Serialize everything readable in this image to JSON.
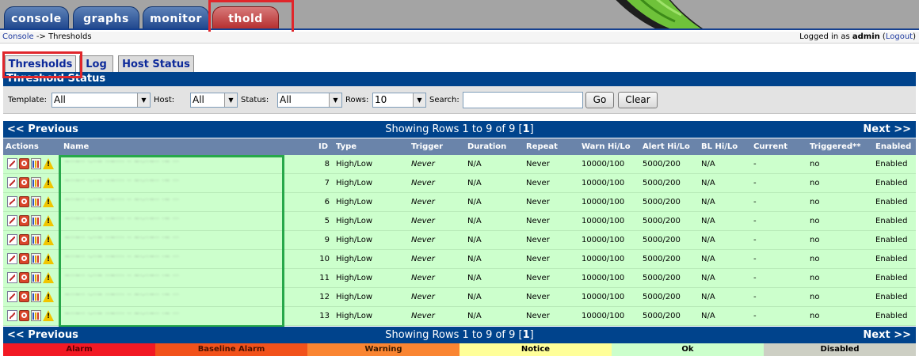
{
  "main_tabs": [
    {
      "label": "console"
    },
    {
      "label": "graphs"
    },
    {
      "label": "monitor"
    },
    {
      "label": "thold"
    }
  ],
  "breadcrumb": {
    "link": "Console",
    "separator": " -> ",
    "current": "Thresholds"
  },
  "login": {
    "prefix": "Logged in as ",
    "user": "admin",
    "open": " (",
    "logout": "Logout",
    "close": ")"
  },
  "sub_tabs": [
    {
      "label": "Thresholds"
    },
    {
      "label": "Log"
    },
    {
      "label": "Host Status"
    }
  ],
  "status_header": "Threshold Status",
  "filters": {
    "template_label": "Template:",
    "template_value": "All",
    "host_label": "Host:",
    "host_value": "All",
    "status_label": "Status:",
    "status_value": "All",
    "rows_label": "Rows:",
    "rows_value": "10",
    "search_label": "Search:",
    "search_value": "",
    "go_label": "Go",
    "clear_label": "Clear"
  },
  "nav": {
    "previous": "<< Previous",
    "showing": "Showing Rows 1 to 9 of 9 [",
    "page": "1",
    "showing_end": "]",
    "next": "Next >>"
  },
  "columns": [
    "Actions",
    "Name",
    "ID",
    "Type",
    "Trigger",
    "Duration",
    "Repeat",
    "Warn Hi/Lo",
    "Alert Hi/Lo",
    "BL Hi/Lo",
    "Current",
    "Triggered**",
    "Enabled"
  ],
  "rows": [
    {
      "id": "8",
      "type": "High/Low",
      "trigger": "Never",
      "duration": "N/A",
      "repeat": "Never",
      "warn": "10000/100",
      "alert": "5000/200",
      "bl": "N/A",
      "current": "-",
      "triggered": "no",
      "enabled": "Enabled"
    },
    {
      "id": "7",
      "type": "High/Low",
      "trigger": "Never",
      "duration": "N/A",
      "repeat": "Never",
      "warn": "10000/100",
      "alert": "5000/200",
      "bl": "N/A",
      "current": "-",
      "triggered": "no",
      "enabled": "Enabled"
    },
    {
      "id": "6",
      "type": "High/Low",
      "trigger": "Never",
      "duration": "N/A",
      "repeat": "Never",
      "warn": "10000/100",
      "alert": "5000/200",
      "bl": "N/A",
      "current": "-",
      "triggered": "no",
      "enabled": "Enabled"
    },
    {
      "id": "5",
      "type": "High/Low",
      "trigger": "Never",
      "duration": "N/A",
      "repeat": "Never",
      "warn": "10000/100",
      "alert": "5000/200",
      "bl": "N/A",
      "current": "-",
      "triggered": "no",
      "enabled": "Enabled"
    },
    {
      "id": "9",
      "type": "High/Low",
      "trigger": "Never",
      "duration": "N/A",
      "repeat": "Never",
      "warn": "10000/100",
      "alert": "5000/200",
      "bl": "N/A",
      "current": "-",
      "triggered": "no",
      "enabled": "Enabled"
    },
    {
      "id": "10",
      "type": "High/Low",
      "trigger": "Never",
      "duration": "N/A",
      "repeat": "Never",
      "warn": "10000/100",
      "alert": "5000/200",
      "bl": "N/A",
      "current": "-",
      "triggered": "no",
      "enabled": "Enabled"
    },
    {
      "id": "11",
      "type": "High/Low",
      "trigger": "Never",
      "duration": "N/A",
      "repeat": "Never",
      "warn": "10000/100",
      "alert": "5000/200",
      "bl": "N/A",
      "current": "-",
      "triggered": "no",
      "enabled": "Enabled"
    },
    {
      "id": "12",
      "type": "High/Low",
      "trigger": "Never",
      "duration": "N/A",
      "repeat": "Never",
      "warn": "10000/100",
      "alert": "5000/200",
      "bl": "N/A",
      "current": "-",
      "triggered": "no",
      "enabled": "Enabled"
    },
    {
      "id": "13",
      "type": "High/Low",
      "trigger": "Never",
      "duration": "N/A",
      "repeat": "Never",
      "warn": "10000/100",
      "alert": "5000/200",
      "bl": "N/A",
      "current": "-",
      "triggered": "no",
      "enabled": "Enabled"
    }
  ],
  "legend": [
    {
      "label": "Alarm",
      "color": "#f21924",
      "text_color": "#5a0000"
    },
    {
      "label": "Baseline Alarm",
      "color": "#f2521b",
      "text_color": "#4a1200"
    },
    {
      "label": "Warning",
      "color": "#fa8532",
      "text_color": "#3a1a00"
    },
    {
      "label": "Notice",
      "color": "#ffff99",
      "text_color": "#000000"
    },
    {
      "label": "Ok",
      "color": "#ccffcc",
      "text_color": "#000000"
    },
    {
      "label": "Disabled",
      "color": "#cdcfc4",
      "text_color": "#000000"
    }
  ],
  "colors": {
    "header_blue": "#00438c",
    "column_header": "#6a84aa",
    "row_ok": "#ccffcc",
    "thold_tab": "#b32a2a",
    "highlight_red": "#e0262b",
    "highlight_green": "#27a84a"
  }
}
